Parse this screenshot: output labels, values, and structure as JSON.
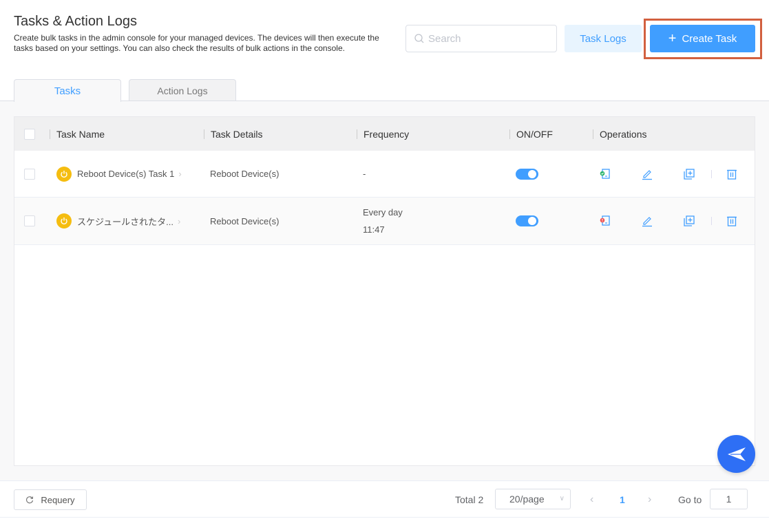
{
  "header": {
    "title": "Tasks & Action Logs",
    "description": "Create bulk tasks in the admin console for your managed devices. The devices will then execute the tasks based on your settings. You can also check the results of bulk actions in the console."
  },
  "toolbar": {
    "search_placeholder": "Search",
    "search_value": "",
    "task_logs_label": "Task Logs",
    "create_task_label": "Create Task"
  },
  "tabs": [
    {
      "label": "Tasks",
      "active": true
    },
    {
      "label": "Action Logs",
      "active": false
    }
  ],
  "table": {
    "columns": [
      "Task Name",
      "Task Details",
      "Frequency",
      "ON/OFF",
      "Operations"
    ],
    "rows": [
      {
        "name": "Reboot Device(s) Task 1",
        "details": "Reboot Device(s)",
        "frequency_line1": "-",
        "frequency_line2": "",
        "enabled": true,
        "status": "success",
        "status_color": "#2cb56b"
      },
      {
        "name": "スケジュールされたタ...",
        "details": "Reboot Device(s)",
        "frequency_line1": "Every day",
        "frequency_line2": "11:47",
        "enabled": true,
        "status": "error",
        "status_color": "#f05656"
      }
    ]
  },
  "footer": {
    "requery_label": "Requery",
    "total_label": "Total 2",
    "page_size": "20/page",
    "current_page": "1",
    "goto_label": "Go to",
    "goto_value": "1"
  },
  "colors": {
    "accent": "#409eff",
    "highlight": "#d2603f",
    "task_icon": "#f5bd10",
    "fab": "#2e6ff5"
  }
}
